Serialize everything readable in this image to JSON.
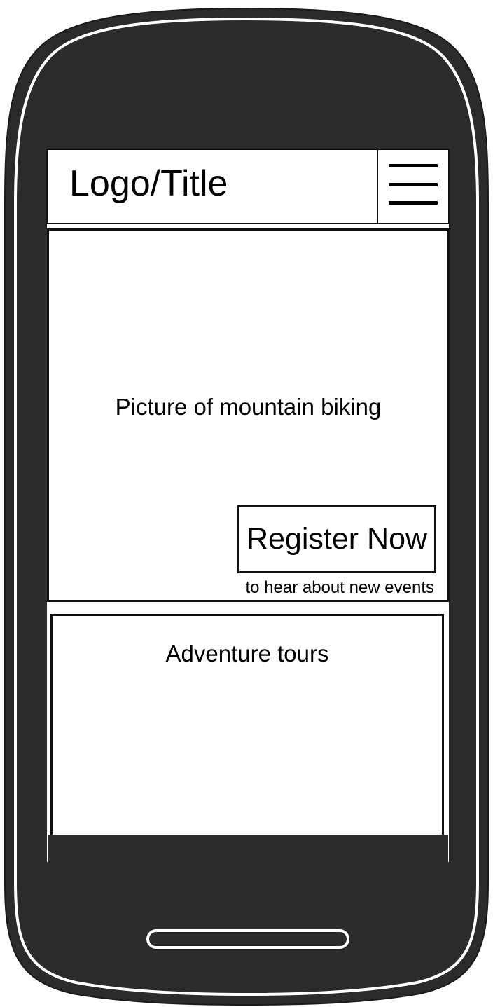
{
  "header": {
    "logo_title": "Logo/Title",
    "menu_icon": "hamburger-menu-icon"
  },
  "hero": {
    "caption": "Picture of mountain biking",
    "register_button": "Register Now",
    "register_note": "to hear about new events"
  },
  "tours": {
    "title": "Adventure tours"
  },
  "colors": {
    "phone_body": "#2b2b2b",
    "phone_outline": "#ffffff",
    "screen_background": "#ffffff",
    "line": "#111111"
  }
}
